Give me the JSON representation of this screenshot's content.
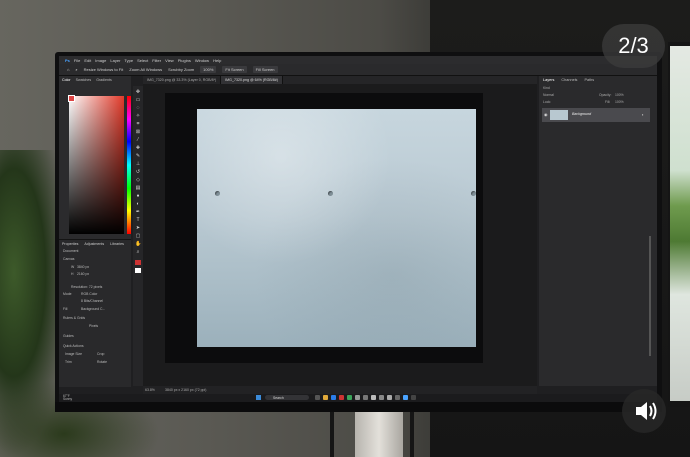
{
  "overlay": {
    "image_counter": "2/3",
    "sound_icon": "speaker-icon"
  },
  "photoshop": {
    "menu": [
      "Ps",
      "File",
      "Edit",
      "Image",
      "Layer",
      "Type",
      "Select",
      "Filter",
      "View",
      "Plugins",
      "Window",
      "Help"
    ],
    "options": {
      "resize": "Resize Windows to Fit",
      "zoom_all": "Zoom All Windows",
      "scrubby": "Scrubby Zoom",
      "zoom_pct": "100%",
      "fit": "Fit Screen",
      "fill": "Fill Screen"
    },
    "tabs": [
      {
        "label": "IMG_7320.png @ 33.3% (Layer 0, RGB/8*)",
        "active": false
      },
      {
        "label": "IMG_7320.png @ 64% (RGB/8#)",
        "active": true
      }
    ],
    "left_panel": {
      "tabs": [
        "Color",
        "Swatches",
        "Gradients"
      ],
      "props_tabs": [
        "Properties",
        "Adjustments",
        "Libraries"
      ],
      "document": "Document",
      "canvas": "Canvas",
      "w_label": "W",
      "w_value": "3840 px",
      "h_label": "H",
      "h_value": "2160 px",
      "resolution": "Resolution: 72 pixels",
      "mode_label": "Mode",
      "mode_value": "RGB Color",
      "depth_value": "8 Bits/Channel",
      "fill_label": "Fill",
      "fill_value": "Background C...",
      "rulers": "Rulers & Grids",
      "guides": "Guides",
      "quick_actions": "Quick Actions",
      "image_size": "Image Size",
      "crop": "Crop",
      "trim": "Trim",
      "rotate": "Rotate",
      "pixels": "Pixels"
    },
    "right_panel": {
      "tabs": [
        "Layers",
        "Channels",
        "Paths"
      ],
      "kind": "Kind",
      "blend": "Normal",
      "opacity_label": "Opacity:",
      "opacity": "100%",
      "lock": "Lock:",
      "fill_label": "Fill:",
      "fill": "100%",
      "layer_name": "Background"
    },
    "status": {
      "zoom": "63.8%",
      "dims": "3840 px x 2160 px (72 ppi)"
    },
    "taskbar": {
      "weather_temp": "67°F",
      "weather_text": "Sunny",
      "search": "Search"
    }
  },
  "colors": {
    "accent": "#4aa3ff",
    "concrete": "#b9c9d2"
  }
}
